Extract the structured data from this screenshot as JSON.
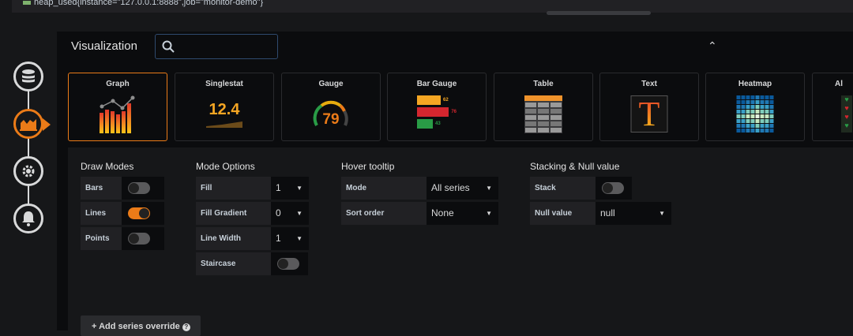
{
  "legend_text": "heap_used{instance=\"127.0.0.1:8888\",job=\"monitor-demo\"}",
  "legend_color": "#7eb26d",
  "accent": "#eb7b18",
  "steps": [
    "queries-icon",
    "visualization-icon",
    "general-settings-icon",
    "alert-icon"
  ],
  "visualization": {
    "title": "Visualization",
    "search_value": ""
  },
  "cards": [
    {
      "label": "Graph",
      "selected": true
    },
    {
      "label": "Singlestat",
      "value": "12.4"
    },
    {
      "label": "Gauge",
      "value": "79"
    },
    {
      "label": "Bar Gauge",
      "values": [
        "62",
        "76",
        "43"
      ]
    },
    {
      "label": "Table"
    },
    {
      "label": "Text",
      "glyph": "T"
    },
    {
      "label": "Heatmap"
    },
    {
      "label": "Al"
    }
  ],
  "draw_modes": {
    "title": "Draw Modes",
    "items": [
      {
        "label": "Bars",
        "on": false
      },
      {
        "label": "Lines",
        "on": true
      },
      {
        "label": "Points",
        "on": false
      }
    ]
  },
  "mode_options": {
    "title": "Mode Options",
    "items": [
      {
        "label": "Fill",
        "value": "1"
      },
      {
        "label": "Fill Gradient",
        "value": "0"
      },
      {
        "label": "Line Width",
        "value": "1"
      }
    ],
    "staircase": {
      "label": "Staircase",
      "on": false
    }
  },
  "hover_tooltip": {
    "title": "Hover tooltip",
    "items": [
      {
        "label": "Mode",
        "value": "All series"
      },
      {
        "label": "Sort order",
        "value": "None"
      }
    ]
  },
  "stacking": {
    "title": "Stacking & Null value",
    "stack": {
      "label": "Stack",
      "on": false
    },
    "null_value": {
      "label": "Null value",
      "value": "null"
    }
  },
  "add_override": "+ Add series override"
}
